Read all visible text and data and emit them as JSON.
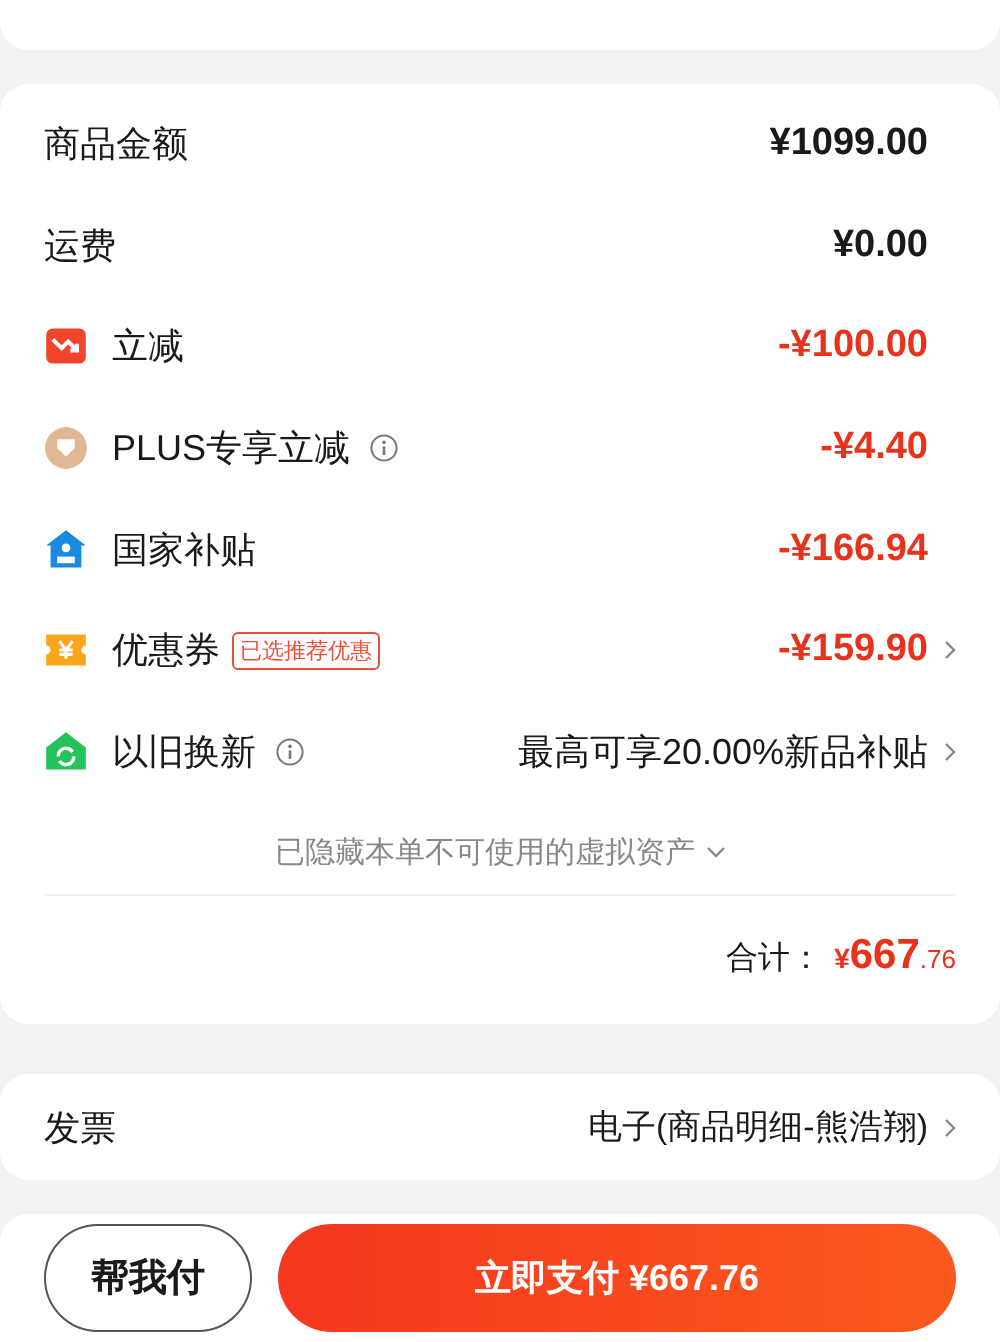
{
  "summary": {
    "rows": [
      {
        "kind": "plain",
        "label": "商品金额",
        "value": "¥1099.00",
        "info": false,
        "chevron": false
      },
      {
        "kind": "plain",
        "label": "运费",
        "value": "¥0.00",
        "info": false,
        "chevron": false
      },
      {
        "kind": "cut",
        "label": "立减",
        "value": "-¥100.00",
        "info": false,
        "chevron": false
      },
      {
        "kind": "plus",
        "label": "PLUS专享立减",
        "value": "-¥4.40",
        "info": true,
        "chevron": false
      },
      {
        "kind": "subsidy",
        "label": "国家补贴",
        "value": "-¥166.94",
        "info": false,
        "chevron": false
      },
      {
        "kind": "coupon",
        "label": "优惠券",
        "tag": "已选推荐优惠",
        "value": "-¥159.90",
        "info": false,
        "chevron": true
      },
      {
        "kind": "tradein",
        "label": "以旧换新",
        "value": "最高可享20.00%新品补贴",
        "info": true,
        "chevron": true
      }
    ],
    "hidden_note": "已隐藏本单不可使用的虚拟资产",
    "total": {
      "label": "合计：",
      "currency": "¥",
      "integer": "667",
      "decimal": ".76"
    }
  },
  "invoice": {
    "label": "发票",
    "value": "电子(商品明细-熊浩翔)"
  },
  "actions": {
    "secondary": "帮我付",
    "primary": "立即支付 ¥667.76"
  }
}
